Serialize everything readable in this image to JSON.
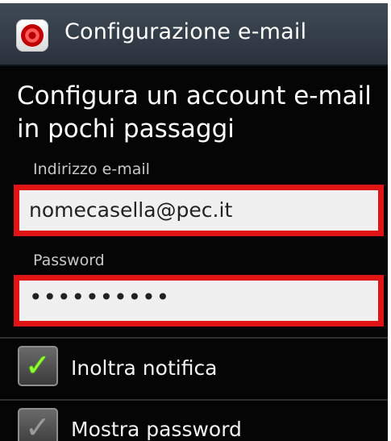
{
  "titlebar": {
    "title": "Configurazione e-mail",
    "icon": "email-app-icon"
  },
  "form": {
    "heading": "Configura un account e-mail in pochi passaggi",
    "email": {
      "label": "Indirizzo e-mail",
      "value": "nomecasella@pec.it"
    },
    "password": {
      "label": "Password",
      "value": "••••••••••"
    }
  },
  "options": {
    "forward_notification": {
      "label": "Inoltra notifica",
      "checked": true
    },
    "show_password": {
      "label": "Mostra password",
      "checked": true
    }
  },
  "colors": {
    "highlight_border": "#e01414",
    "checkmark_active": "#8cff2d"
  }
}
